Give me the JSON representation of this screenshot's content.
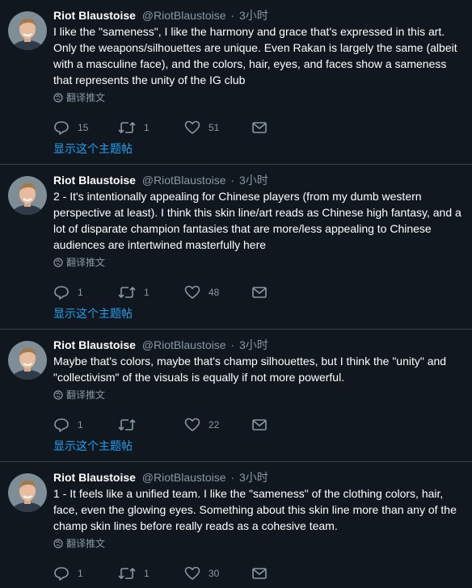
{
  "tweets": [
    {
      "name": "Riot Blaustoise",
      "handle": "@RiotBlaustoise",
      "dot": "·",
      "time": "3小时",
      "text": "I like the \"sameness\", I like the harmony and grace that's expressed in this art. Only the weapons/silhouettes are unique. Even Rakan is largely the same (albeit with a masculine face), and the colors, hair, eyes, and faces show a sameness that represents the unity of the IG club",
      "translate": "翻译推文",
      "replies": "15",
      "retweets": "1",
      "likes": "51",
      "thread_link": "显示这个主题帖"
    },
    {
      "name": "Riot Blaustoise",
      "handle": "@RiotBlaustoise",
      "dot": "·",
      "time": "3小时",
      "text": "2 - It's intentionally appealing for Chinese players (from my dumb western perspective at least). I think this skin line/art reads as Chinese high fantasy, and a lot of disparate champion fantasies that are more/less appealing to Chinese audiences are intertwined masterfully here",
      "translate": "翻译推文",
      "replies": "1",
      "retweets": "1",
      "likes": "48",
      "thread_link": "显示这个主题帖"
    },
    {
      "name": "Riot Blaustoise",
      "handle": "@RiotBlaustoise",
      "dot": "·",
      "time": "3小时",
      "text": "Maybe that's colors, maybe that's champ silhouettes, but I think the \"unity\" and \"collectivism\" of the visuals is equally if not more powerful.",
      "translate": "翻译推文",
      "replies": "1",
      "retweets": "",
      "likes": "22",
      "thread_link": "显示这个主题帖"
    },
    {
      "name": "Riot Blaustoise",
      "handle": "@RiotBlaustoise",
      "dot": "·",
      "time": "3小时",
      "text": "1 - It feels like a unified team. I like the \"sameness\" of the clothing colors, hair, face, even the glowing eyes. Something about this skin line more than any of the champ skin lines before really reads as a cohesive team.",
      "translate": "翻译推文",
      "replies": "1",
      "retweets": "1",
      "likes": "30",
      "thread_link": ""
    }
  ],
  "colors": {
    "background": "#10171e",
    "text": "#ffffff",
    "secondary": "#8899a6",
    "link": "#1da1f2",
    "divider": "#38444d"
  }
}
